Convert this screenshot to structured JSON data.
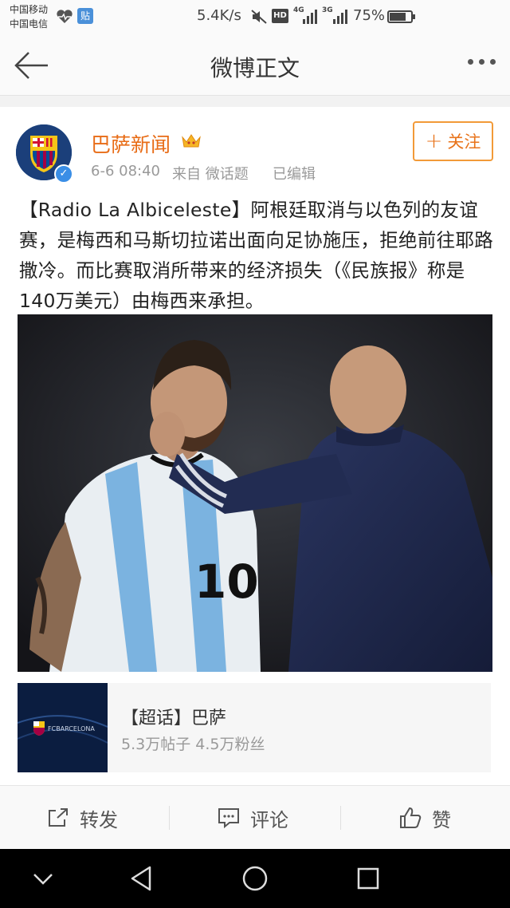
{
  "status_bar": {
    "carrier_1": "中国移动",
    "carrier_2": "中国电信",
    "notif_app": "贴",
    "speed": "5.4K/s",
    "hd": "HD",
    "net_1": "4G",
    "net_2": "3G",
    "battery": "75%",
    "battery_level": 0.75
  },
  "header": {
    "title": "微博正文"
  },
  "post": {
    "username": "巴萨新闻",
    "time": "6-6 08:40",
    "source": "来自 微话题",
    "edited": "已编辑",
    "follow_label": "关注",
    "text": "【Radio La Albiceleste】阿根廷取消与以色列的友谊赛，是梅西和马斯切拉诺出面向足协施压，拒绝前往耶路撒冷。而比赛取消所带来的经济损失（《民族报》称是140万美元）由梅西来承担。",
    "photo_jersey_number": "10"
  },
  "topic": {
    "name": "【超话】巴萨",
    "stats": "5.3万帖子 4.5万粉丝",
    "thumb_text": "FCBARCELONA"
  },
  "actions": {
    "repost": "转发",
    "comment": "评论",
    "like": "赞"
  },
  "colors": {
    "accent_orange": "#e86c16",
    "follow_border": "#f29a38",
    "verified_blue": "#3a8ee6"
  }
}
